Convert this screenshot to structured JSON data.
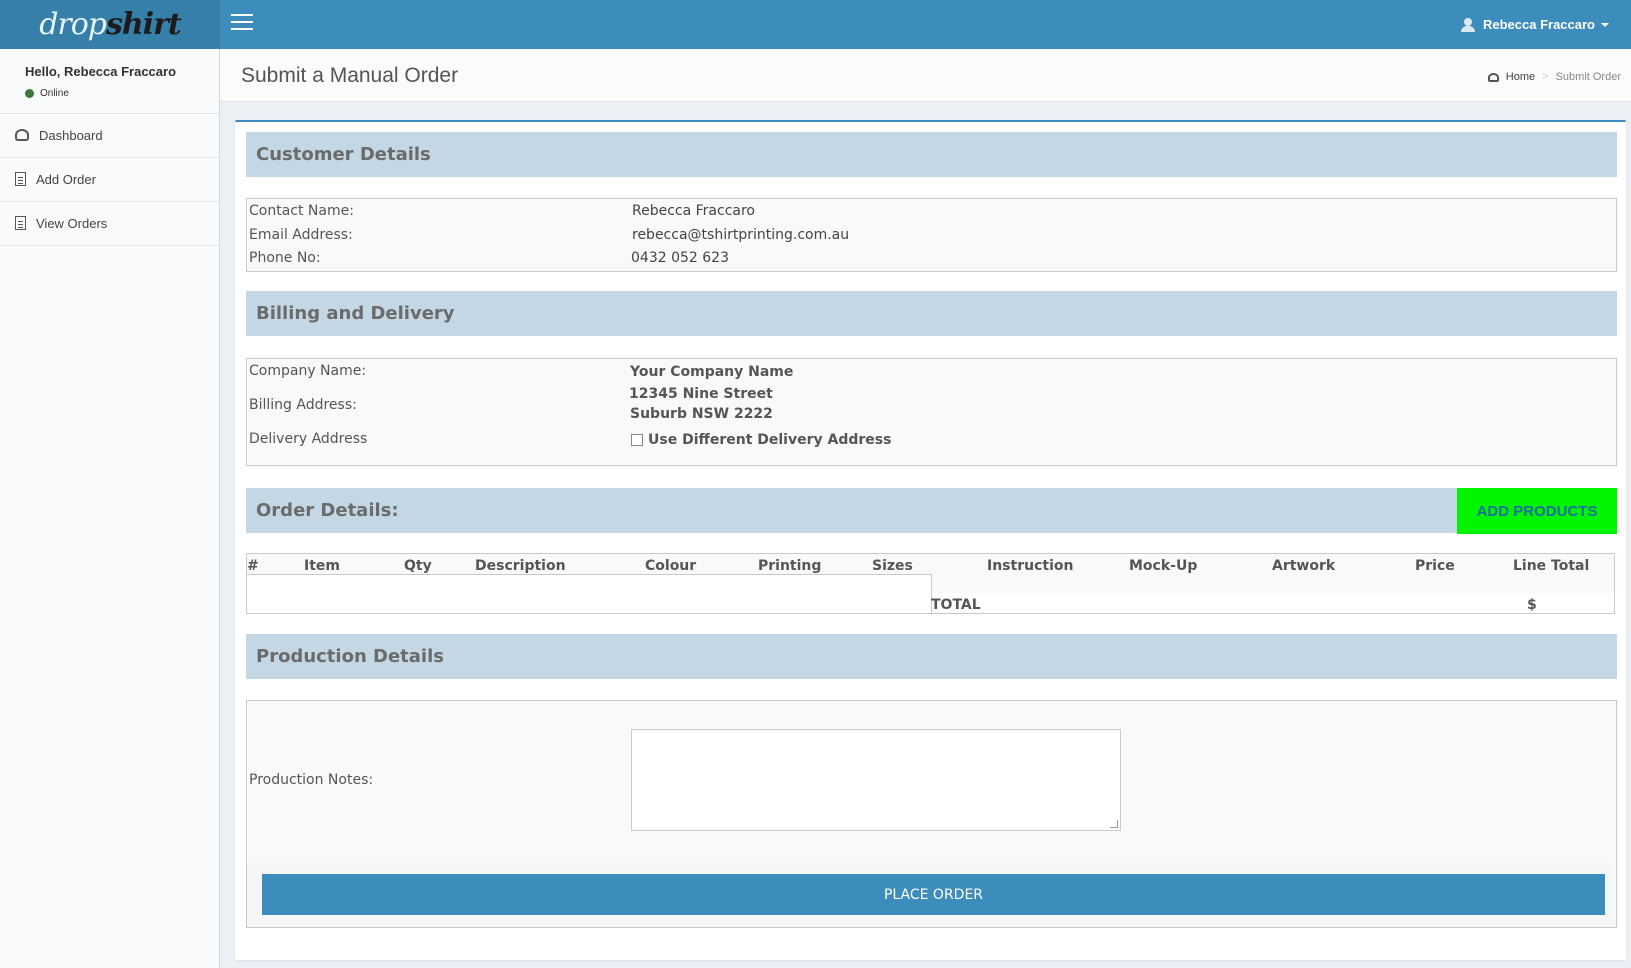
{
  "brand": {
    "logo_light": "drop",
    "logo_dark": "shirt"
  },
  "topbar": {
    "user_name": "Rebecca Fraccaro"
  },
  "sidebar": {
    "hello": "Hello, Rebecca Fraccaro",
    "status": "Online",
    "items": [
      {
        "label": "Dashboard",
        "icon": "dashboard-icon"
      },
      {
        "label": "Add Order",
        "icon": "file-icon"
      },
      {
        "label": "View Orders",
        "icon": "file-icon"
      }
    ]
  },
  "header": {
    "title": "Submit a Manual Order",
    "breadcrumb": {
      "home": "Home",
      "sep": ">",
      "current": "Submit Order"
    }
  },
  "customer": {
    "heading": "Customer Details",
    "contact_label": "Contact Name:",
    "contact_value": "Rebecca Fraccaro",
    "email_label": "Email Address:",
    "email_value": "rebecca@tshirtprinting.com.au",
    "phone_label": "Phone No:",
    "phone_value": "0432 052 623"
  },
  "billing": {
    "heading": "Billing and Delivery",
    "company_label": "Company Name:",
    "company_value": "Your Company Name",
    "address_label": "Billing Address:",
    "address_line1": "12345 Nine Street",
    "address_line2": "Suburb NSW 2222",
    "delivery_label": "Delivery Address",
    "delivery_checkbox": "Use Different Delivery Address"
  },
  "order": {
    "heading": "Order Details:",
    "add_button": "ADD PRODUCTS",
    "columns": [
      "#",
      "Item",
      "Qty",
      "Description",
      "Colour",
      "Printing",
      "Sizes",
      "Instruction",
      "Mock-Up",
      "Artwork",
      "Price",
      "Line Total"
    ],
    "total_label": "TOTAL",
    "total_value": "$"
  },
  "production": {
    "heading": "Production Details",
    "notes_label": "Production Notes:",
    "notes_value": "",
    "place_button": "PLACE ORDER"
  },
  "colors": {
    "brand_blue": "#3c8dbc",
    "section_bg": "#c3d8e4",
    "add_button": "#00f400"
  }
}
